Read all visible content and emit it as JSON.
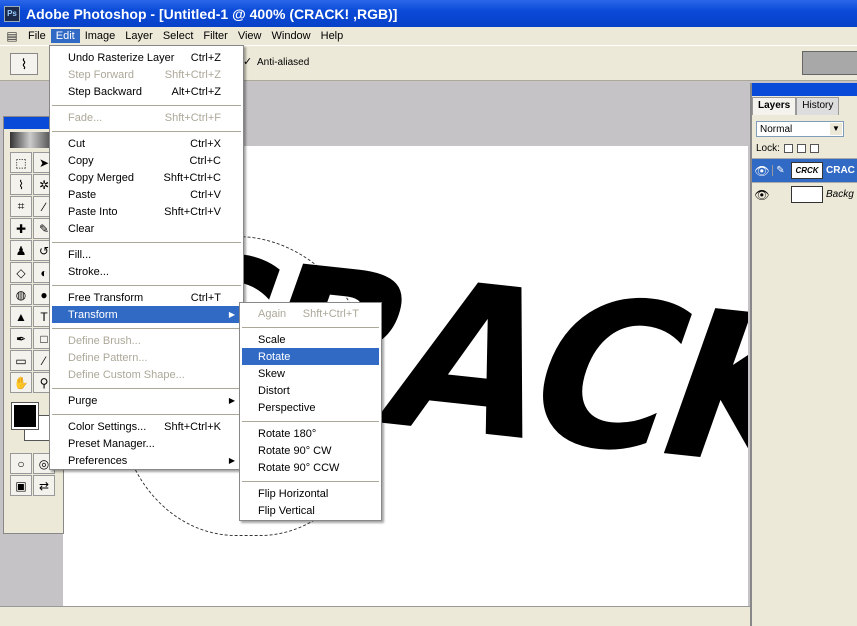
{
  "window": {
    "title": "Adobe Photoshop - [Untitled-1 @ 400% (CRACK! ,RGB)]"
  },
  "menubar": [
    "File",
    "Edit",
    "Image",
    "Layer",
    "Select",
    "Filter",
    "View",
    "Window",
    "Help"
  ],
  "options": {
    "antialiased": "Anti-aliased"
  },
  "canvas": {
    "text": "CRACK!"
  },
  "edit_menu": [
    {
      "label": "Undo Rasterize Layer",
      "shortcut": "Ctrl+Z"
    },
    {
      "label": "Step Forward",
      "shortcut": "Shft+Ctrl+Z",
      "disabled": true
    },
    {
      "label": "Step Backward",
      "shortcut": "Alt+Ctrl+Z"
    },
    {
      "sep": true
    },
    {
      "label": "Fade...",
      "shortcut": "Shft+Ctrl+F",
      "disabled": true
    },
    {
      "sep": true
    },
    {
      "label": "Cut",
      "shortcut": "Ctrl+X"
    },
    {
      "label": "Copy",
      "shortcut": "Ctrl+C"
    },
    {
      "label": "Copy Merged",
      "shortcut": "Shft+Ctrl+C"
    },
    {
      "label": "Paste",
      "shortcut": "Ctrl+V"
    },
    {
      "label": "Paste Into",
      "shortcut": "Shft+Ctrl+V"
    },
    {
      "label": "Clear",
      "shortcut": ""
    },
    {
      "sep": true
    },
    {
      "label": "Fill...",
      "shortcut": ""
    },
    {
      "label": "Stroke...",
      "shortcut": ""
    },
    {
      "sep": true
    },
    {
      "label": "Free Transform",
      "shortcut": "Ctrl+T"
    },
    {
      "label": "Transform",
      "shortcut": "",
      "submenu": true,
      "highlight": true
    },
    {
      "sep": true
    },
    {
      "label": "Define Brush...",
      "shortcut": "",
      "disabled": true
    },
    {
      "label": "Define Pattern...",
      "shortcut": "",
      "disabled": true
    },
    {
      "label": "Define Custom Shape...",
      "shortcut": "",
      "disabled": true
    },
    {
      "sep": true
    },
    {
      "label": "Purge",
      "shortcut": "",
      "submenu": true
    },
    {
      "sep": true
    },
    {
      "label": "Color Settings...",
      "shortcut": "Shft+Ctrl+K"
    },
    {
      "label": "Preset Manager...",
      "shortcut": ""
    },
    {
      "label": "Preferences",
      "shortcut": "",
      "submenu": true
    }
  ],
  "transform_menu": [
    {
      "label": "Again",
      "shortcut": "Shft+Ctrl+T",
      "disabled": true
    },
    {
      "sep": true
    },
    {
      "label": "Scale",
      "shortcut": ""
    },
    {
      "label": "Rotate",
      "shortcut": "",
      "highlight": true
    },
    {
      "label": "Skew",
      "shortcut": ""
    },
    {
      "label": "Distort",
      "shortcut": ""
    },
    {
      "label": "Perspective",
      "shortcut": ""
    },
    {
      "sep": true
    },
    {
      "label": "Rotate 180°",
      "shortcut": ""
    },
    {
      "label": "Rotate 90° CW",
      "shortcut": ""
    },
    {
      "label": "Rotate 90° CCW",
      "shortcut": ""
    },
    {
      "sep": true
    },
    {
      "label": "Flip Horizontal",
      "shortcut": ""
    },
    {
      "label": "Flip Vertical",
      "shortcut": ""
    }
  ],
  "layers_panel": {
    "tabs": [
      "Layers",
      "History"
    ],
    "blend_mode": "Normal",
    "lock_label": "Lock:",
    "layers": [
      {
        "name": "CRAC",
        "thumb": "CRCK",
        "active": true
      },
      {
        "name": "Backg",
        "thumb": "",
        "active": false
      }
    ]
  }
}
